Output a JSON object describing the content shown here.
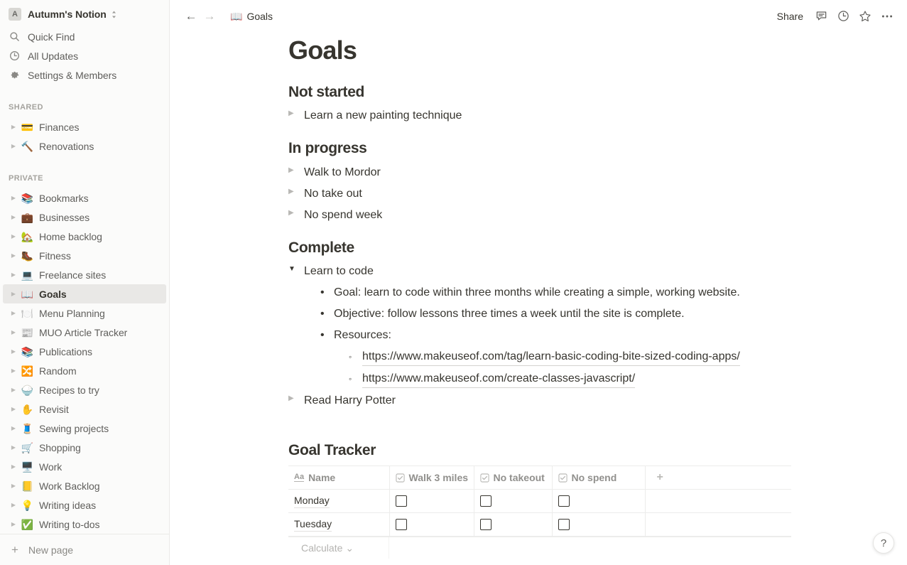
{
  "sidebar": {
    "workspace": {
      "avatar_letter": "A",
      "name": "Autumn's Notion",
      "switcher_icon": "updown-chevron-icon"
    },
    "nav": [
      {
        "label": "Quick Find",
        "icon": "search-icon"
      },
      {
        "label": "All Updates",
        "icon": "clock-icon"
      },
      {
        "label": "Settings & Members",
        "icon": "gear-icon"
      }
    ],
    "shared_header": "SHARED",
    "shared": [
      {
        "emoji": "💳",
        "label": "Finances"
      },
      {
        "emoji": "🔨",
        "label": "Renovations"
      }
    ],
    "private_header": "PRIVATE",
    "private": [
      {
        "emoji": "📚",
        "label": "Bookmarks",
        "active": false
      },
      {
        "emoji": "💼",
        "label": "Businesses",
        "active": false
      },
      {
        "emoji": "🏡",
        "label": "Home backlog",
        "active": false
      },
      {
        "emoji": "🥾",
        "label": "Fitness",
        "active": false
      },
      {
        "emoji": "💻",
        "label": "Freelance sites",
        "active": false
      },
      {
        "emoji": "📖",
        "label": "Goals",
        "active": true
      },
      {
        "emoji": "🍽️",
        "label": "Menu Planning",
        "active": false
      },
      {
        "emoji": "📰",
        "label": "MUO Article Tracker",
        "active": false
      },
      {
        "emoji": "📚",
        "label": "Publications",
        "active": false
      },
      {
        "emoji": "🔀",
        "label": "Random",
        "active": false
      },
      {
        "emoji": "🍚",
        "label": "Recipes to try",
        "active": false
      },
      {
        "emoji": "✋",
        "label": "Revisit",
        "active": false
      },
      {
        "emoji": "🧵",
        "label": "Sewing projects",
        "active": false
      },
      {
        "emoji": "🛒",
        "label": "Shopping",
        "active": false
      },
      {
        "emoji": "🖥️",
        "label": "Work",
        "active": false
      },
      {
        "emoji": "📒",
        "label": "Work Backlog",
        "active": false
      },
      {
        "emoji": "💡",
        "label": "Writing ideas",
        "active": false
      },
      {
        "emoji": "✅",
        "label": "Writing to-dos",
        "active": false
      }
    ],
    "new_page": {
      "label": "New page",
      "icon": "plus-icon"
    }
  },
  "topbar": {
    "back_icon": "arrow-left-icon",
    "forward_icon": "arrow-right-icon",
    "breadcrumb": {
      "emoji": "📖",
      "label": "Goals"
    },
    "share_label": "Share",
    "comment_icon": "comment-icon",
    "history_icon": "clock-icon",
    "favorite_icon": "star-icon",
    "more_icon": "ellipsis-icon"
  },
  "page": {
    "title": "Goals",
    "sections": [
      {
        "heading": "Not started",
        "items": [
          {
            "label": "Learn a new painting technique",
            "expanded": false
          }
        ]
      },
      {
        "heading": "In progress",
        "items": [
          {
            "label": "Walk to Mordor",
            "expanded": false
          },
          {
            "label": "No take out",
            "expanded": false
          },
          {
            "label": "No spend week",
            "expanded": false
          }
        ]
      },
      {
        "heading": "Complete",
        "items": [
          {
            "label": "Learn to code",
            "expanded": true
          },
          {
            "label": "Read Harry Potter",
            "expanded": false
          }
        ]
      }
    ],
    "learn_to_code_details": {
      "bullets": [
        "Goal: learn to code within three months while creating a simple, working website.",
        "Objective: follow lessons three times a week until the site is complete.",
        "Resources:"
      ],
      "links": [
        "https://www.makeuseof.com/tag/learn-basic-coding-bite-sized-coding-apps/",
        "https://www.makeuseof.com/create-classes-javascript/"
      ]
    },
    "tracker": {
      "heading": "Goal Tracker",
      "columns": [
        {
          "label": "Name",
          "icon": "text-aa-icon"
        },
        {
          "label": "Walk 3 miles",
          "icon": "checkbox-icon"
        },
        {
          "label": "No takeout",
          "icon": "checkbox-icon"
        },
        {
          "label": "No spend",
          "icon": "checkbox-icon"
        }
      ],
      "add_column_icon": "plus-icon",
      "rows": [
        {
          "name": "Monday",
          "walk_3_miles": false,
          "no_takeout": false,
          "no_spend": false
        },
        {
          "name": "Tuesday",
          "walk_3_miles": false,
          "no_takeout": false,
          "no_spend": false
        }
      ],
      "calculate_label": "Calculate",
      "calculate_chevron": "chevron-down-icon"
    }
  },
  "help_button": {
    "label": "?",
    "icon": "question-mark-icon"
  }
}
